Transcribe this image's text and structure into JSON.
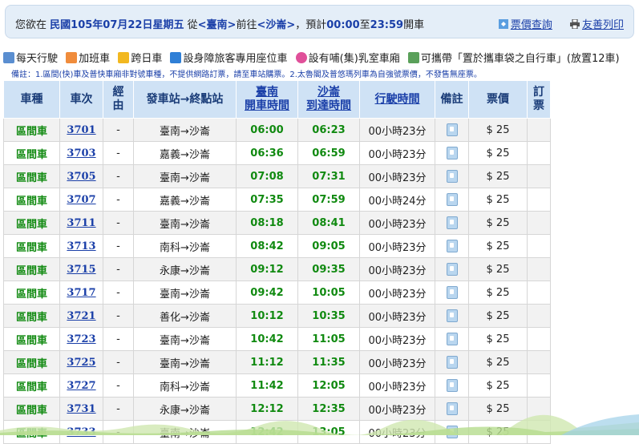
{
  "query": {
    "prefix": "您欲在",
    "date": "民國105年07月22日星期五",
    "from_word": "從",
    "origin": "<臺南>",
    "to_word": "前往",
    "destination": "<沙崙>",
    "range_prefix": "，預計",
    "time_from": "00:00",
    "range_mid": "至",
    "time_to": "23:59",
    "suffix": "開車"
  },
  "links": {
    "fare_query": "票價查詢",
    "print": "友善列印"
  },
  "legend": [
    {
      "label": "每天行駛",
      "icon": "daily-icon",
      "color": "#5a8ed0"
    },
    {
      "label": "加班車",
      "icon": "extra-train-icon",
      "color": "#f08c3c"
    },
    {
      "label": "跨日車",
      "icon": "overnight-icon",
      "color": "#f2b820"
    },
    {
      "label": "設身障旅客專用座位車",
      "icon": "wheelchair-icon",
      "color": "#2f7fd6"
    },
    {
      "label": "設有哺(集)乳室車廂",
      "icon": "nursing-room-icon",
      "color": "#e0509a"
    },
    {
      "label": "可攜帶「置於攜車袋之自行車」(放置12車)",
      "icon": "bicycle-icon",
      "color": "#5aa05a"
    }
  ],
  "note": "備註：1.區間(快)車及普快車廂非對號車種，不提供網路訂票，請至車站購票。2.太魯閣及普悠瑪列車為自強號票價，不發售無座票。",
  "table": {
    "headers": {
      "type": "車種",
      "train_no": "車次",
      "via": "經由",
      "route": "發車站→終點站",
      "dep_line1": "臺南",
      "dep_line2": "開車時間",
      "arr_line1": "沙崙",
      "arr_line2": "到達時間",
      "duration": "行駛時間",
      "remark": "備註",
      "fare": "票價",
      "book": "訂票"
    },
    "rows": [
      {
        "type": "區間車",
        "no": "3701",
        "via": "-",
        "route": "臺南→沙崙",
        "dep": "06:00",
        "arr": "06:23",
        "dur": "00小時23分",
        "fare": "$ 25"
      },
      {
        "type": "區間車",
        "no": "3703",
        "via": "-",
        "route": "嘉義→沙崙",
        "dep": "06:36",
        "arr": "06:59",
        "dur": "00小時23分",
        "fare": "$ 25"
      },
      {
        "type": "區間車",
        "no": "3705",
        "via": "-",
        "route": "臺南→沙崙",
        "dep": "07:08",
        "arr": "07:31",
        "dur": "00小時23分",
        "fare": "$ 25"
      },
      {
        "type": "區間車",
        "no": "3707",
        "via": "-",
        "route": "嘉義→沙崙",
        "dep": "07:35",
        "arr": "07:59",
        "dur": "00小時24分",
        "fare": "$ 25"
      },
      {
        "type": "區間車",
        "no": "3711",
        "via": "-",
        "route": "臺南→沙崙",
        "dep": "08:18",
        "arr": "08:41",
        "dur": "00小時23分",
        "fare": "$ 25"
      },
      {
        "type": "區間車",
        "no": "3713",
        "via": "-",
        "route": "南科→沙崙",
        "dep": "08:42",
        "arr": "09:05",
        "dur": "00小時23分",
        "fare": "$ 25"
      },
      {
        "type": "區間車",
        "no": "3715",
        "via": "-",
        "route": "永康→沙崙",
        "dep": "09:12",
        "arr": "09:35",
        "dur": "00小時23分",
        "fare": "$ 25"
      },
      {
        "type": "區間車",
        "no": "3717",
        "via": "-",
        "route": "臺南→沙崙",
        "dep": "09:42",
        "arr": "10:05",
        "dur": "00小時23分",
        "fare": "$ 25"
      },
      {
        "type": "區間車",
        "no": "3721",
        "via": "-",
        "route": "善化→沙崙",
        "dep": "10:12",
        "arr": "10:35",
        "dur": "00小時23分",
        "fare": "$ 25"
      },
      {
        "type": "區間車",
        "no": "3723",
        "via": "-",
        "route": "臺南→沙崙",
        "dep": "10:42",
        "arr": "11:05",
        "dur": "00小時23分",
        "fare": "$ 25"
      },
      {
        "type": "區間車",
        "no": "3725",
        "via": "-",
        "route": "臺南→沙崙",
        "dep": "11:12",
        "arr": "11:35",
        "dur": "00小時23分",
        "fare": "$ 25"
      },
      {
        "type": "區間車",
        "no": "3727",
        "via": "-",
        "route": "南科→沙崙",
        "dep": "11:42",
        "arr": "12:05",
        "dur": "00小時23分",
        "fare": "$ 25"
      },
      {
        "type": "區間車",
        "no": "3731",
        "via": "-",
        "route": "永康→沙崙",
        "dep": "12:12",
        "arr": "12:35",
        "dur": "00小時23分",
        "fare": "$ 25"
      },
      {
        "type": "區間車",
        "no": "3733",
        "via": "-",
        "route": "臺南→沙崙",
        "dep": "12:42",
        "arr": "13:05",
        "dur": "00小時23分",
        "fare": "$ 25"
      }
    ]
  },
  "colors": {
    "header_bg": "#cfe2f5",
    "train_type_green": "#118a11",
    "link_blue": "#1a3fa8",
    "alt_row": "#f2f2f2"
  }
}
